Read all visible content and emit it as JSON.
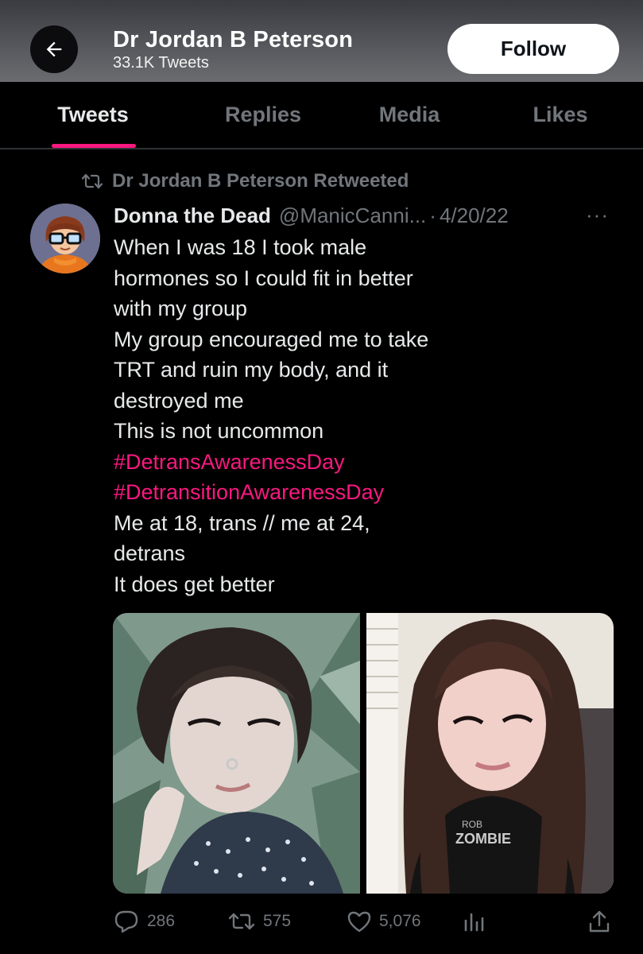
{
  "header": {
    "name": "Dr Jordan B Peterson",
    "tweet_count": "33.1K Tweets",
    "follow_label": "Follow"
  },
  "tabs": [
    {
      "label": "Tweets",
      "active": true
    },
    {
      "label": "Replies",
      "active": false
    },
    {
      "label": "Media",
      "active": false
    },
    {
      "label": "Likes",
      "active": false
    }
  ],
  "accent_color": "#f91880",
  "tweet": {
    "retweeted_by": "Dr Jordan B Peterson Retweeted",
    "author": "Donna the Dead",
    "handle": "@ManicCanni...",
    "separator": "·",
    "date": "4/20/22",
    "more": "···",
    "lines": [
      "When I was 18 I took male",
      "hormones so I could fit in better",
      "with my group",
      "My group encouraged me to take",
      "TRT and ruin my body, and it",
      "destroyed me",
      "This is not uncommon"
    ],
    "hashtags": [
      "#DetransAwarenessDay",
      "#DetransitionAwarenessDay"
    ],
    "lines_after": [
      "Me at 18, trans // me at 24,",
      "detrans",
      "It does get better"
    ],
    "media_shirt_text": "ROB ZOMBIE"
  },
  "actions": {
    "replies": "286",
    "retweets": "575",
    "likes": "5,076"
  },
  "icons": [
    "back-arrow-icon",
    "retweet-icon",
    "more-icon",
    "reply-icon",
    "like-icon",
    "views-icon",
    "share-icon"
  ]
}
